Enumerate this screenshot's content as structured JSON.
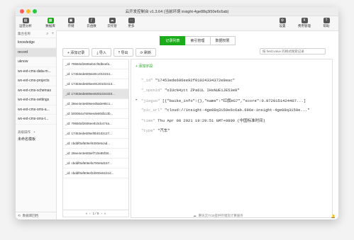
{
  "window": {
    "title": "云开发控制台 v1.3.64 (当前环境 insight-4ge88q3i50e6c6ab)"
  },
  "toolbar": {
    "items": [
      {
        "label": "运营分析",
        "icon": "chart-icon"
      },
      {
        "label": "数据库",
        "icon": "database-icon"
      },
      {
        "label": "存储",
        "icon": "storage-icon"
      },
      {
        "label": "云函数",
        "icon": "function-icon"
      },
      {
        "label": "云托管",
        "icon": "cloud-hosting-icon"
      },
      {
        "label": "更多",
        "icon": "more-icon"
      }
    ],
    "right_items": [
      {
        "label": "设置",
        "icon": "gear-icon"
      },
      {
        "label": "费用管理",
        "icon": "billing-icon"
      },
      {
        "label": "帮助",
        "icon": "help-icon"
      }
    ]
  },
  "sidebar": {
    "header": "集合名称",
    "collections": [
      "knowledge",
      "record",
      "uknow",
      "wx-ext-cms-data-m...",
      "wx-ext-cms-projects",
      "wx-ext-cms-schemas",
      "wx-ext-cms-settings",
      "wx-ext-cms-sms-a...",
      "wx-ext-cms-sms-t..."
    ],
    "advanced_label": "高级操作",
    "template_label": "未命名模板",
    "footer_label": "数据库回档"
  },
  "tabs": [
    "记录列表",
    "索引管理",
    "数据权限"
  ],
  "actions": {
    "add": "+ 添加记录",
    "import": "⤓ 导入",
    "export": "⤒ 导出",
    "refresh": "⟳ 刷新"
  },
  "search": {
    "placeholder": "按 field:value 的格式搜索记录"
  },
  "records": [
    "_id: 79550af2606eb2cf0dbeefa...",
    "_id: 17453ede606ee8cc010234...",
    "_id: 17453ede606ee9130102413...",
    "_id: 17453ede606ee9201024333...",
    "_id: 28ee4e3e606eed5a0e95c1...",
    "_id: b00064a7606eede80db13b...",
    "_id: 79550af2606ee810dc474a...",
    "_id: 17453ede606ef0b0102c27...",
    "_id: cbddf0af606ef4000e5cad...",
    "_id: 28ee4e3e606ef710e95f38...",
    "_id: cbddf0af606efa700e5d157...",
    "_id: cbddf0af606ef2d000e61b1d..."
  ],
  "pager": {
    "prev": "«",
    "prev_one": "‹",
    "text": "1 / 9",
    "next_one": "›",
    "next": "»"
  },
  "detail": {
    "add_field": "+ 添加字段",
    "fields": [
      {
        "key": "\"_id\"",
        "value": "\"17453ede606ee92f01024334372e9eac\""
      },
      {
        "key": "\"_openid\"",
        "value": "\"oIUcN4ytt ZPa61L IHsNUE1JE53e8\""
      },
      {
        "key": "\"jieguo\"",
        "value": "[{\"baike_info\":{},\"name\":\"红旗HS7\",\"score\":0.9720151424407...]"
      },
      {
        "key": "\"pic_url\"",
        "value": "\"cloud://insight-4ge88q3i50e6c6ab.696e-insight-4ge88q3i50e...\""
      },
      {
        "key": "\"time\"",
        "value": "Thu Apr 08 2021 19:29:51 GMT+0800 (中国标准时间)"
      },
      {
        "key": "\"type\"",
        "value": "\"汽车\""
      }
    ]
  },
  "footer": {
    "text": "腾讯云TCB提供存储及计算服务"
  }
}
